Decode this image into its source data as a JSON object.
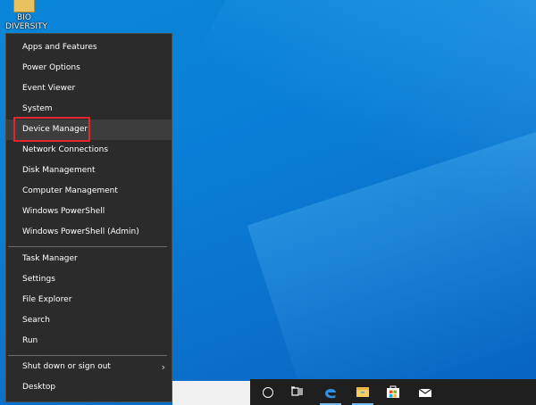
{
  "desktop": {
    "icon_label": "BIO DIVERSITY"
  },
  "menu": {
    "group1": [
      "Apps and Features",
      "Power Options",
      "Event Viewer",
      "System",
      "Device Manager",
      "Network Connections",
      "Disk Management",
      "Computer Management",
      "Windows PowerShell",
      "Windows PowerShell (Admin)"
    ],
    "group2": [
      "Task Manager",
      "Settings",
      "File Explorer",
      "Search",
      "Run"
    ],
    "group3": [
      "Shut down or sign out",
      "Desktop"
    ],
    "highlighted_item": "Device Manager",
    "submenu_chevron": "›"
  },
  "taskbar": {
    "icons": [
      "cortana-icon",
      "task-view-icon",
      "edge-icon",
      "file-explorer-icon",
      "store-icon",
      "mail-icon"
    ],
    "accent_color": "#76b9ed"
  },
  "colors": {
    "menu_background": "#2b2b2b",
    "highlight_border": "#e3262c",
    "desktop_blue": "#0a7fd6"
  }
}
